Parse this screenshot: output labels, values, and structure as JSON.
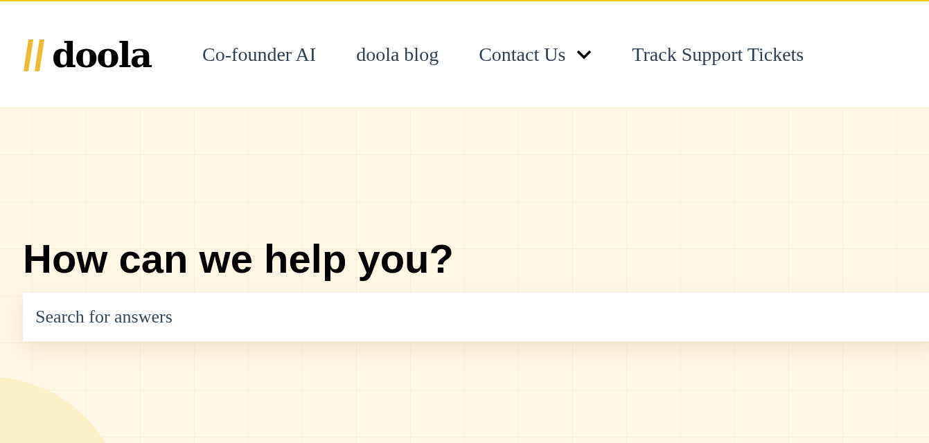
{
  "header": {
    "logo": {
      "wordmark": "doola"
    },
    "nav": [
      {
        "label": "Co-founder AI",
        "has_dropdown": false
      },
      {
        "label": "doola blog",
        "has_dropdown": false
      },
      {
        "label": "Contact Us",
        "has_dropdown": true
      },
      {
        "label": "Track Support Tickets",
        "has_dropdown": false
      }
    ]
  },
  "hero": {
    "heading": "How can we help you?",
    "search": {
      "placeholder": "Search for answers"
    }
  }
}
